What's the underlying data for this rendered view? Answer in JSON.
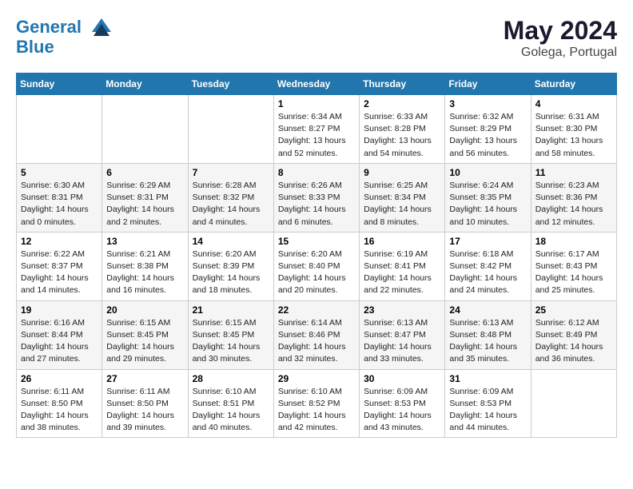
{
  "header": {
    "logo_line1": "General",
    "logo_line2": "Blue",
    "month": "May 2024",
    "location": "Golega, Portugal"
  },
  "weekdays": [
    "Sunday",
    "Monday",
    "Tuesday",
    "Wednesday",
    "Thursday",
    "Friday",
    "Saturday"
  ],
  "weeks": [
    [
      {
        "day": "",
        "info": ""
      },
      {
        "day": "",
        "info": ""
      },
      {
        "day": "",
        "info": ""
      },
      {
        "day": "1",
        "info": "Sunrise: 6:34 AM\nSunset: 8:27 PM\nDaylight: 13 hours\nand 52 minutes."
      },
      {
        "day": "2",
        "info": "Sunrise: 6:33 AM\nSunset: 8:28 PM\nDaylight: 13 hours\nand 54 minutes."
      },
      {
        "day": "3",
        "info": "Sunrise: 6:32 AM\nSunset: 8:29 PM\nDaylight: 13 hours\nand 56 minutes."
      },
      {
        "day": "4",
        "info": "Sunrise: 6:31 AM\nSunset: 8:30 PM\nDaylight: 13 hours\nand 58 minutes."
      }
    ],
    [
      {
        "day": "5",
        "info": "Sunrise: 6:30 AM\nSunset: 8:31 PM\nDaylight: 14 hours\nand 0 minutes."
      },
      {
        "day": "6",
        "info": "Sunrise: 6:29 AM\nSunset: 8:31 PM\nDaylight: 14 hours\nand 2 minutes."
      },
      {
        "day": "7",
        "info": "Sunrise: 6:28 AM\nSunset: 8:32 PM\nDaylight: 14 hours\nand 4 minutes."
      },
      {
        "day": "8",
        "info": "Sunrise: 6:26 AM\nSunset: 8:33 PM\nDaylight: 14 hours\nand 6 minutes."
      },
      {
        "day": "9",
        "info": "Sunrise: 6:25 AM\nSunset: 8:34 PM\nDaylight: 14 hours\nand 8 minutes."
      },
      {
        "day": "10",
        "info": "Sunrise: 6:24 AM\nSunset: 8:35 PM\nDaylight: 14 hours\nand 10 minutes."
      },
      {
        "day": "11",
        "info": "Sunrise: 6:23 AM\nSunset: 8:36 PM\nDaylight: 14 hours\nand 12 minutes."
      }
    ],
    [
      {
        "day": "12",
        "info": "Sunrise: 6:22 AM\nSunset: 8:37 PM\nDaylight: 14 hours\nand 14 minutes."
      },
      {
        "day": "13",
        "info": "Sunrise: 6:21 AM\nSunset: 8:38 PM\nDaylight: 14 hours\nand 16 minutes."
      },
      {
        "day": "14",
        "info": "Sunrise: 6:20 AM\nSunset: 8:39 PM\nDaylight: 14 hours\nand 18 minutes."
      },
      {
        "day": "15",
        "info": "Sunrise: 6:20 AM\nSunset: 8:40 PM\nDaylight: 14 hours\nand 20 minutes."
      },
      {
        "day": "16",
        "info": "Sunrise: 6:19 AM\nSunset: 8:41 PM\nDaylight: 14 hours\nand 22 minutes."
      },
      {
        "day": "17",
        "info": "Sunrise: 6:18 AM\nSunset: 8:42 PM\nDaylight: 14 hours\nand 24 minutes."
      },
      {
        "day": "18",
        "info": "Sunrise: 6:17 AM\nSunset: 8:43 PM\nDaylight: 14 hours\nand 25 minutes."
      }
    ],
    [
      {
        "day": "19",
        "info": "Sunrise: 6:16 AM\nSunset: 8:44 PM\nDaylight: 14 hours\nand 27 minutes."
      },
      {
        "day": "20",
        "info": "Sunrise: 6:15 AM\nSunset: 8:45 PM\nDaylight: 14 hours\nand 29 minutes."
      },
      {
        "day": "21",
        "info": "Sunrise: 6:15 AM\nSunset: 8:45 PM\nDaylight: 14 hours\nand 30 minutes."
      },
      {
        "day": "22",
        "info": "Sunrise: 6:14 AM\nSunset: 8:46 PM\nDaylight: 14 hours\nand 32 minutes."
      },
      {
        "day": "23",
        "info": "Sunrise: 6:13 AM\nSunset: 8:47 PM\nDaylight: 14 hours\nand 33 minutes."
      },
      {
        "day": "24",
        "info": "Sunrise: 6:13 AM\nSunset: 8:48 PM\nDaylight: 14 hours\nand 35 minutes."
      },
      {
        "day": "25",
        "info": "Sunrise: 6:12 AM\nSunset: 8:49 PM\nDaylight: 14 hours\nand 36 minutes."
      }
    ],
    [
      {
        "day": "26",
        "info": "Sunrise: 6:11 AM\nSunset: 8:50 PM\nDaylight: 14 hours\nand 38 minutes."
      },
      {
        "day": "27",
        "info": "Sunrise: 6:11 AM\nSunset: 8:50 PM\nDaylight: 14 hours\nand 39 minutes."
      },
      {
        "day": "28",
        "info": "Sunrise: 6:10 AM\nSunset: 8:51 PM\nDaylight: 14 hours\nand 40 minutes."
      },
      {
        "day": "29",
        "info": "Sunrise: 6:10 AM\nSunset: 8:52 PM\nDaylight: 14 hours\nand 42 minutes."
      },
      {
        "day": "30",
        "info": "Sunrise: 6:09 AM\nSunset: 8:53 PM\nDaylight: 14 hours\nand 43 minutes."
      },
      {
        "day": "31",
        "info": "Sunrise: 6:09 AM\nSunset: 8:53 PM\nDaylight: 14 hours\nand 44 minutes."
      },
      {
        "day": "",
        "info": ""
      }
    ]
  ]
}
